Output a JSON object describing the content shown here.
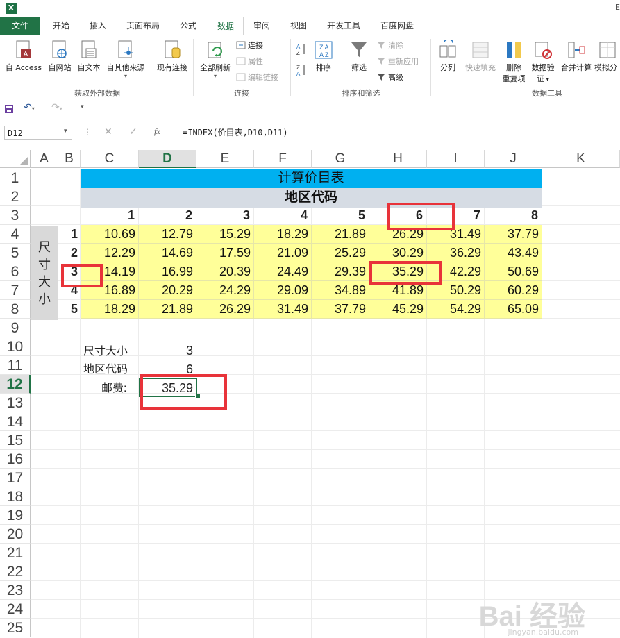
{
  "app": {
    "icon_letter": "X",
    "title_fragment": "E"
  },
  "tabs": [
    {
      "label": "文件",
      "key": "file"
    },
    {
      "label": "开始",
      "key": "home"
    },
    {
      "label": "插入",
      "key": "insert"
    },
    {
      "label": "页面布局",
      "key": "layout"
    },
    {
      "label": "公式",
      "key": "formulas"
    },
    {
      "label": "数据",
      "key": "data"
    },
    {
      "label": "审阅",
      "key": "review"
    },
    {
      "label": "视图",
      "key": "view"
    },
    {
      "label": "开发工具",
      "key": "developer"
    },
    {
      "label": "百度网盘",
      "key": "baidu"
    }
  ],
  "active_tab": "数据",
  "ribbon": {
    "get_external": {
      "from_access": "自 Access",
      "from_web": "自网站",
      "from_text": "自文本",
      "from_other": "自其他来源",
      "existing": "现有连接",
      "group_label": "获取外部数据"
    },
    "connections": {
      "refresh_all": "全部刷新",
      "connections": "连接",
      "properties": "属性",
      "edit_links": "编辑链接",
      "group_label": "连接"
    },
    "sort_filter": {
      "sort": "排序",
      "filter": "筛选",
      "clear": "清除",
      "reapply": "重新应用",
      "advanced": "高级",
      "group_label": "排序和筛选"
    },
    "data_tools": {
      "text_to_columns": "分列",
      "flash_fill": "快速填充",
      "remove_dup_1": "删除",
      "remove_dup_2": "重复项",
      "validation_1": "数据验",
      "validation_2": "证",
      "consolidate": "合并计算",
      "what_if": "模拟分",
      "group_label": "数据工具"
    }
  },
  "formula_bar": {
    "name_box": "D12",
    "fx": "fx",
    "formula": "=INDEX(价目表,D10,D11)"
  },
  "columns": [
    "A",
    "B",
    "C",
    "D",
    "E",
    "F",
    "G",
    "H",
    "I",
    "J",
    "K"
  ],
  "selected_column": "D",
  "rows": [
    "1",
    "2",
    "3",
    "4",
    "5",
    "6",
    "7",
    "8",
    "9",
    "10",
    "11",
    "12",
    "13",
    "14",
    "15",
    "16",
    "17",
    "18",
    "19",
    "20",
    "21",
    "22",
    "23",
    "24",
    "25"
  ],
  "selected_row": "12",
  "sheet": {
    "title": "计算价目表",
    "region_header": "地区代码",
    "size_label_chars": [
      "尺",
      "寸",
      "大",
      "小"
    ],
    "region_codes": [
      "1",
      "2",
      "3",
      "4",
      "5",
      "6",
      "7",
      "8"
    ],
    "size_codes": [
      "1",
      "2",
      "3",
      "4",
      "5"
    ],
    "price_table": [
      [
        "10.69",
        "12.79",
        "15.29",
        "18.29",
        "21.89",
        "26.29",
        "31.49",
        "37.79"
      ],
      [
        "12.29",
        "14.69",
        "17.59",
        "21.09",
        "25.29",
        "30.29",
        "36.29",
        "43.49"
      ],
      [
        "14.19",
        "16.99",
        "20.39",
        "24.49",
        "29.39",
        "35.29",
        "42.29",
        "50.69"
      ],
      [
        "16.89",
        "20.29",
        "24.29",
        "29.09",
        "34.89",
        "41.89",
        "50.29",
        "60.29"
      ],
      [
        "18.29",
        "21.89",
        "26.29",
        "31.49",
        "37.79",
        "45.29",
        "54.29",
        "65.09"
      ]
    ],
    "lookup": {
      "size_label": "尺寸大小",
      "size_value": "3",
      "region_label": "地区代码",
      "region_value": "6",
      "postage_label": "邮费:",
      "postage_value": "35.29"
    }
  },
  "colors": {
    "title_fill": "#00b0f0",
    "header_fill": "#d6dce4",
    "table_fill": "#ffff99",
    "side_label_fill": "#d9d9d9",
    "highlight": "#e8333a",
    "excel_green": "#217346"
  },
  "watermark": {
    "main": "Bai 经验",
    "sub": "jingyan.baidu.com"
  }
}
